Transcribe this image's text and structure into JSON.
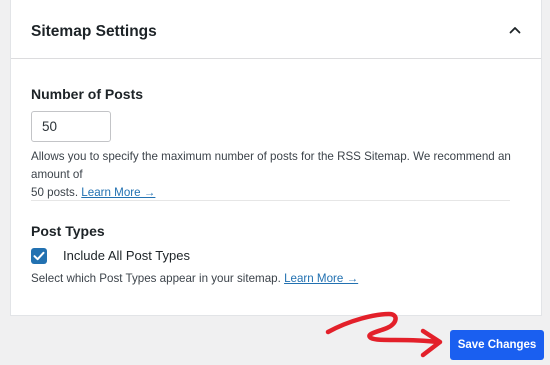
{
  "panel": {
    "title": "Sitemap Settings"
  },
  "number_of_posts": {
    "heading": "Number of Posts",
    "value": "50",
    "help_line_1": "Allows you to specify the maximum number of posts for the RSS Sitemap. We recommend an amount of",
    "help_line_2": "50 posts.",
    "learn_more": "Learn More →"
  },
  "post_types": {
    "heading": "Post Types",
    "checkbox_label": "Include All Post Types",
    "checkbox_checked": true,
    "help": "Select which Post Types appear in your sitemap.",
    "learn_more": "Learn More →"
  },
  "actions": {
    "save_label": "Save Changes"
  },
  "colors": {
    "accent": "#2271b1",
    "primary_button": "#1a5ff0",
    "annotation_arrow": "#e3202a"
  },
  "icons": {
    "collapse": "chevron-up-icon",
    "checkmark": "checkmark-icon",
    "annotation": "arrow-icon"
  }
}
